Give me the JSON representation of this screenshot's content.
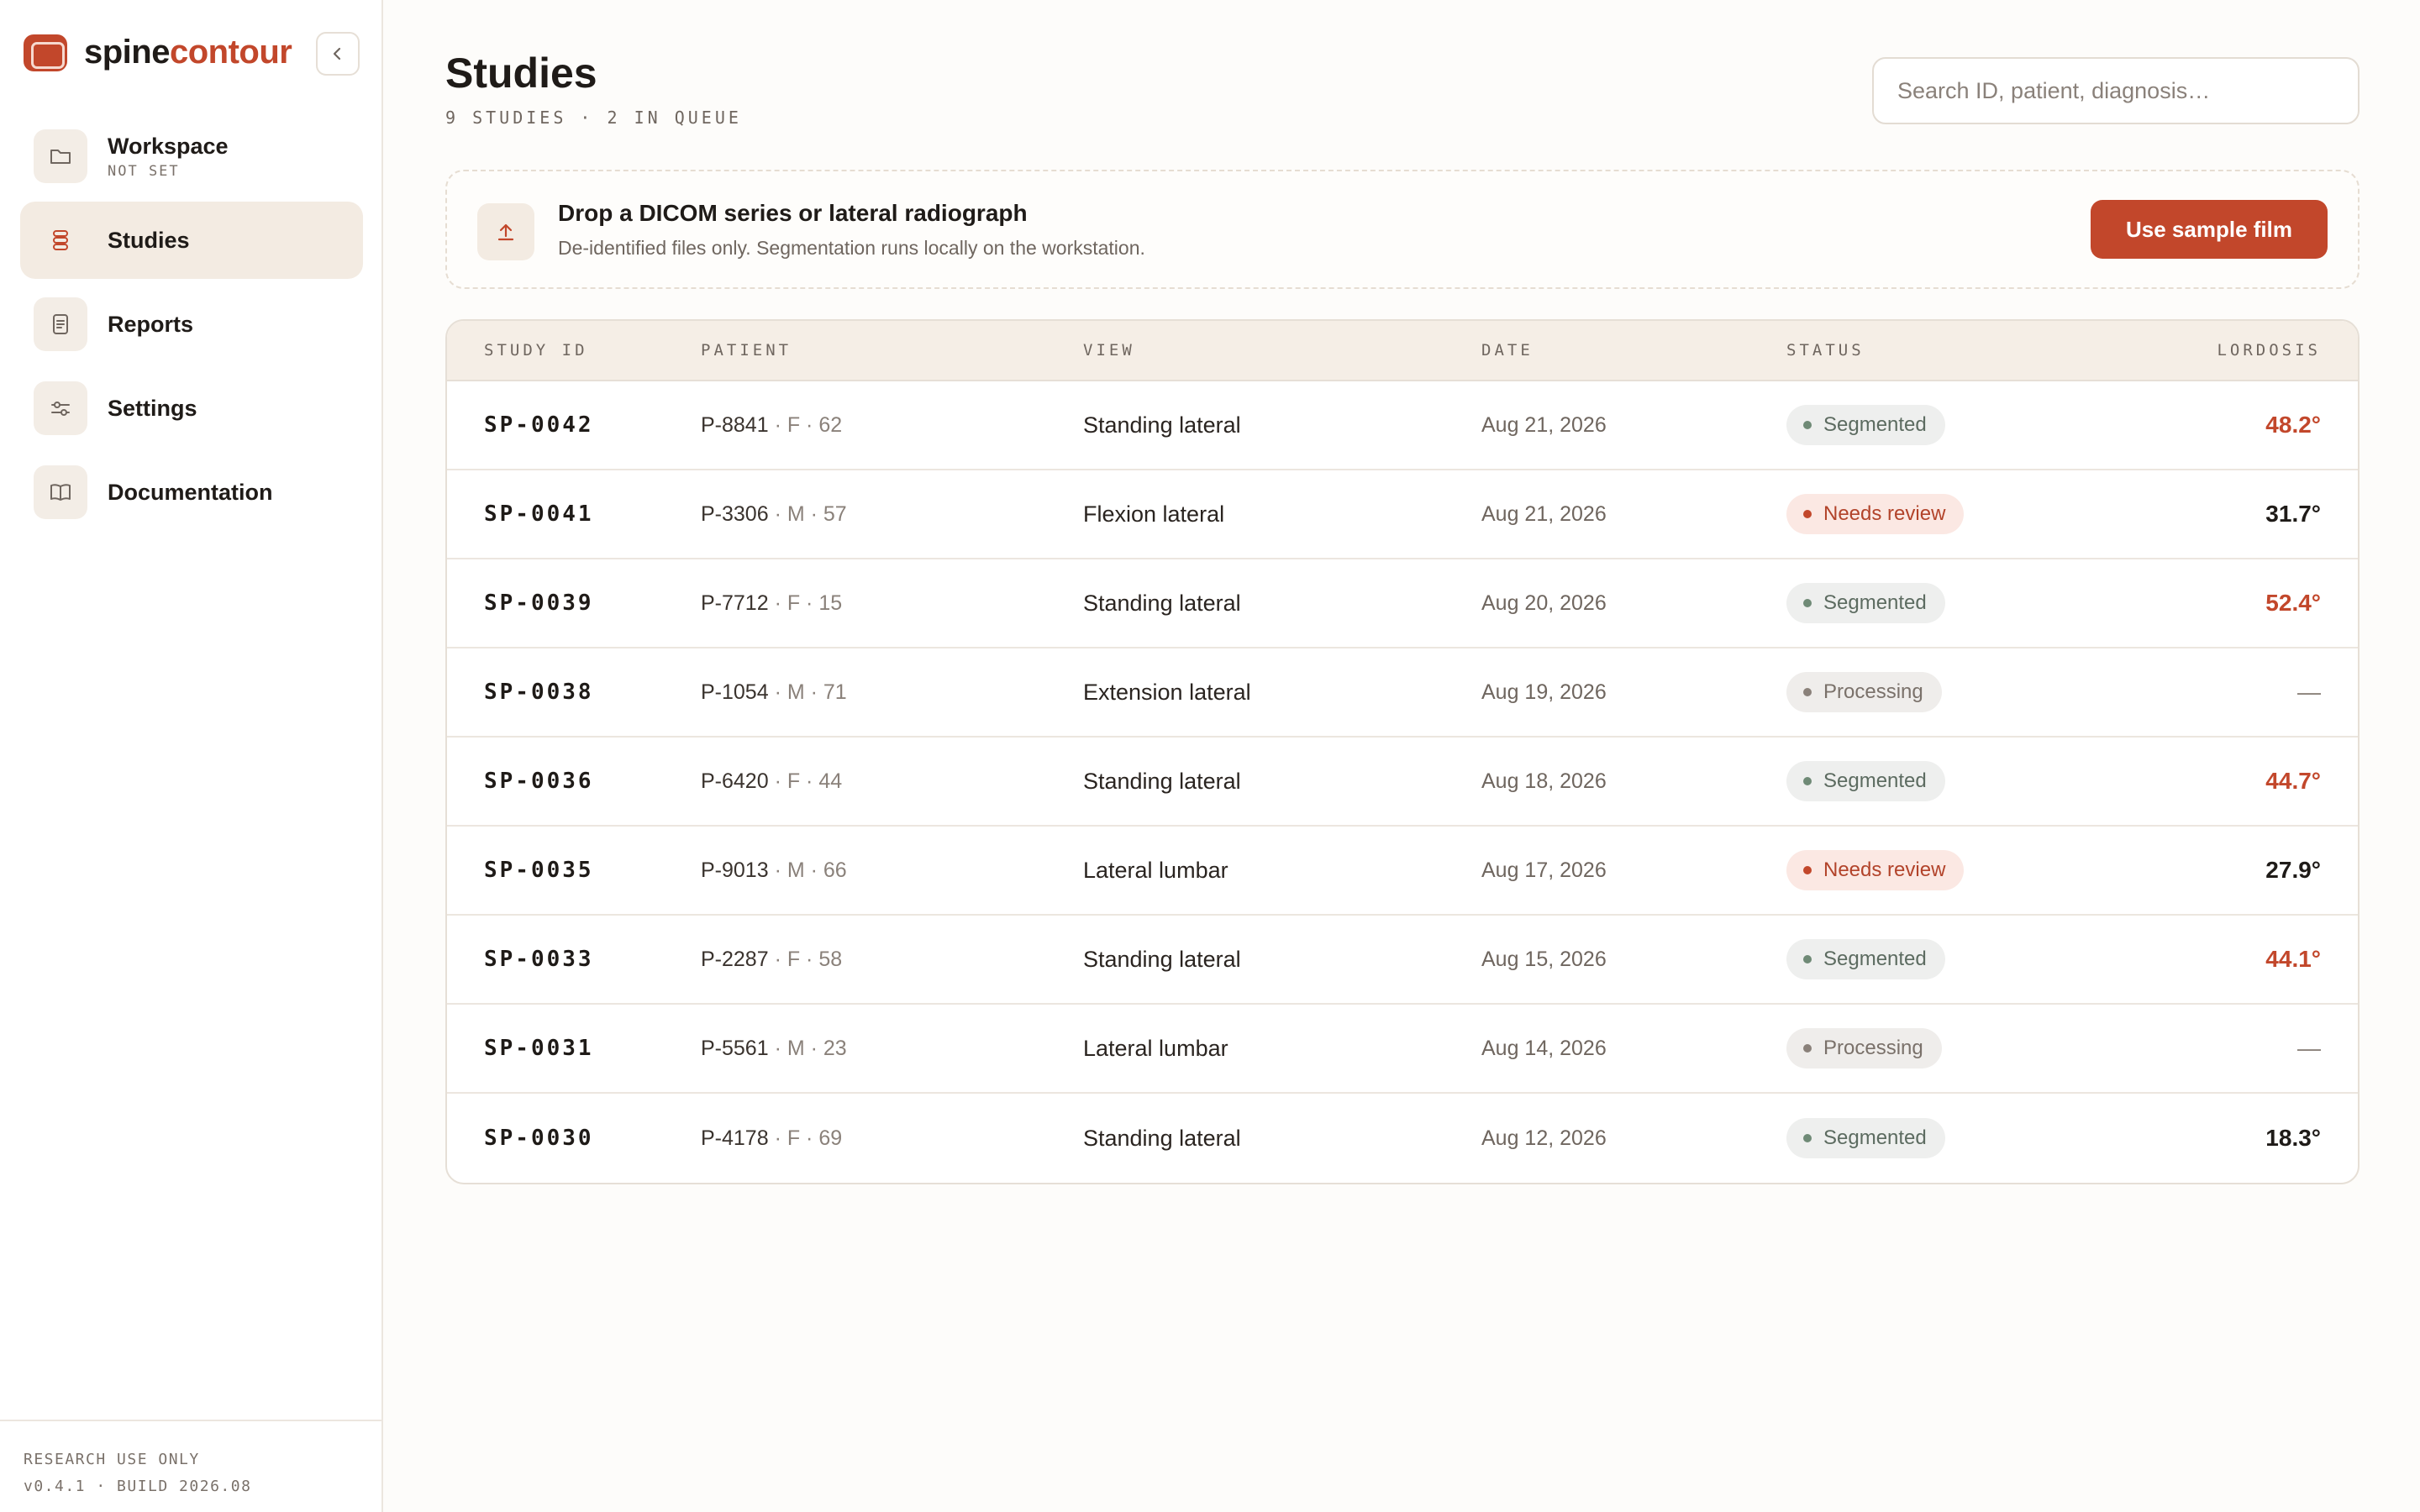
{
  "brand": {
    "name_a": "spine",
    "name_b": "contour",
    "accent": "#c2472b"
  },
  "sidebar": {
    "items": [
      {
        "label": "Workspace",
        "sub": "NOT SET",
        "icon": "folder-icon",
        "active": false
      },
      {
        "label": "Studies",
        "sub": "",
        "icon": "database-icon",
        "active": true
      },
      {
        "label": "Reports",
        "sub": "",
        "icon": "document-icon",
        "active": false
      },
      {
        "label": "Settings",
        "sub": "",
        "icon": "sliders-icon",
        "active": false
      },
      {
        "label": "Documentation",
        "sub": "",
        "icon": "book-icon",
        "active": false
      }
    ],
    "footer_line1": "RESEARCH USE ONLY",
    "footer_line2": "v0.4.1 · BUILD 2026.08"
  },
  "header": {
    "title": "Studies",
    "subtitle": "9 STUDIES · 2 IN QUEUE",
    "search_placeholder": "Search ID, patient, diagnosis…"
  },
  "dropzone": {
    "title": "Drop a DICOM series or lateral radiograph",
    "description": "De-identified files only. Segmentation runs locally on the workstation.",
    "button_label": "Use sample film",
    "icon": "upload-icon"
  },
  "table": {
    "columns": [
      "STUDY ID",
      "PATIENT",
      "VIEW",
      "DATE",
      "STATUS",
      "LORDOSIS"
    ],
    "rows": [
      {
        "id": "SP-0042",
        "patient": "P-8841",
        "meta": " · F · 62",
        "view": "Standing lateral",
        "date": "Aug 21, 2026",
        "status": "Segmented",
        "status_kind": "segmented",
        "lordosis": "48.2°",
        "lordosis_kind": "high"
      },
      {
        "id": "SP-0041",
        "patient": "P-3306",
        "meta": " · M · 57",
        "view": "Flexion lateral",
        "date": "Aug 21, 2026",
        "status": "Needs review",
        "status_kind": "review",
        "lordosis": "31.7°",
        "lordosis_kind": "normal"
      },
      {
        "id": "SP-0039",
        "patient": "P-7712",
        "meta": " · F · 15",
        "view": "Standing lateral",
        "date": "Aug 20, 2026",
        "status": "Segmented",
        "status_kind": "segmented",
        "lordosis": "52.4°",
        "lordosis_kind": "high"
      },
      {
        "id": "SP-0038",
        "patient": "P-1054",
        "meta": " · M · 71",
        "view": "Extension lateral",
        "date": "Aug 19, 2026",
        "status": "Processing",
        "status_kind": "processing",
        "lordosis": "—",
        "lordosis_kind": "none"
      },
      {
        "id": "SP-0036",
        "patient": "P-6420",
        "meta": " · F · 44",
        "view": "Standing lateral",
        "date": "Aug 18, 2026",
        "status": "Segmented",
        "status_kind": "segmented",
        "lordosis": "44.7°",
        "lordosis_kind": "high"
      },
      {
        "id": "SP-0035",
        "patient": "P-9013",
        "meta": " · M · 66",
        "view": "Lateral lumbar",
        "date": "Aug 17, 2026",
        "status": "Needs review",
        "status_kind": "review",
        "lordosis": "27.9°",
        "lordosis_kind": "normal"
      },
      {
        "id": "SP-0033",
        "patient": "P-2287",
        "meta": " · F · 58",
        "view": "Standing lateral",
        "date": "Aug 15, 2026",
        "status": "Segmented",
        "status_kind": "segmented",
        "lordosis": "44.1°",
        "lordosis_kind": "high"
      },
      {
        "id": "SP-0031",
        "patient": "P-5561",
        "meta": " · M · 23",
        "view": "Lateral lumbar",
        "date": "Aug 14, 2026",
        "status": "Processing",
        "status_kind": "processing",
        "lordosis": "—",
        "lordosis_kind": "none"
      },
      {
        "id": "SP-0030",
        "patient": "P-4178",
        "meta": " · F · 69",
        "view": "Standing lateral",
        "date": "Aug 12, 2026",
        "status": "Segmented",
        "status_kind": "segmented",
        "lordosis": "18.3°",
        "lordosis_kind": "normal"
      }
    ]
  }
}
